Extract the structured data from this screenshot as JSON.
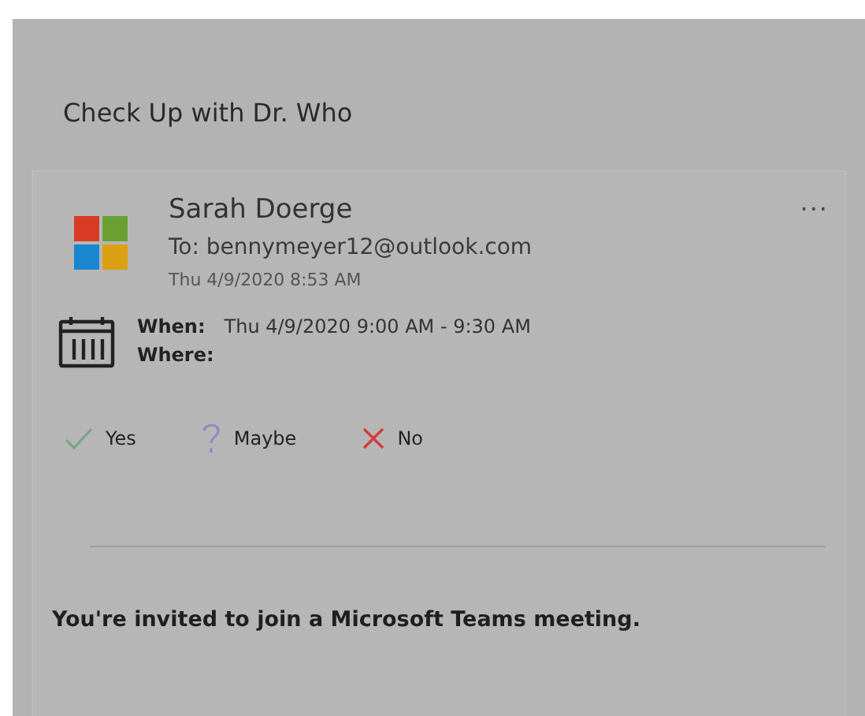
{
  "title": "Check Up with Dr. Who",
  "message": {
    "sender": "Sarah Doerge",
    "to": "To: bennymeyer12@outlook.com",
    "sent": "Thu 4/9/2020 8:53 AM",
    "more": "···"
  },
  "details": [
    {
      "label": "When:",
      "value": "Thu 4/9/2020 9:00 AM - 9:30 AM"
    },
    {
      "label": "Where:"
    }
  ],
  "responses": [
    {
      "kind": "yes",
      "label": "Yes"
    },
    {
      "kind": "maybe",
      "label": "Maybe"
    },
    {
      "kind": "no",
      "label": "No"
    }
  ],
  "body": "You're invited to join a Microsoft Teams meeting."
}
